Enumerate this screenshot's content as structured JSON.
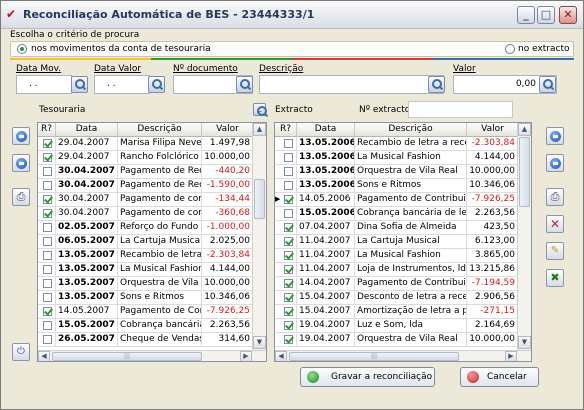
{
  "window": {
    "title": "Reconciliação Automática de BES - 23444333/1",
    "min": "_",
    "max": "□",
    "close": "✕"
  },
  "criteria": {
    "label": "Escolha o critério de procura",
    "option1": "nos movimentos da conta de tesouraria",
    "option2": "no extracto",
    "selected": "option1"
  },
  "filters": {
    "data_mov_label": "Data Mov.",
    "data_mov_value": ". .",
    "data_valor_label": "Data Valor",
    "data_valor_value": ". .",
    "doc_label": "Nº documento",
    "doc_value": "",
    "desc_label": "Descrição",
    "desc_value": "",
    "valor_label": "Valor",
    "valor_value": "0,00"
  },
  "colors": {
    "stripe1": "#f4c430",
    "stripe2": "#2f9a2f",
    "stripe3": "#d33a3a",
    "stripe4": "#3b6ea8",
    "negative": "#d21a1a"
  },
  "tesouraria": {
    "label": "Tesouraria",
    "c_label": "c",
    "columns": [
      "R?",
      "Data",
      "Descrição",
      "Valor"
    ],
    "rows": [
      {
        "checked": true,
        "bold": false,
        "date": "29.04.2007",
        "desc": "Marisa Filipa Neves I",
        "value": "1.497,98",
        "neg": false
      },
      {
        "checked": true,
        "bold": false,
        "date": "29.04.2007",
        "desc": "Rancho Folclórico da",
        "value": "10.000,00",
        "neg": false
      },
      {
        "checked": false,
        "bold": true,
        "date": "30.04.2007",
        "desc": "Pagamento de Recib",
        "value": "-440,20",
        "neg": true
      },
      {
        "checked": false,
        "bold": true,
        "date": "30.04.2007",
        "desc": "Pagamento de Recib",
        "value": "-1.590,00",
        "neg": true
      },
      {
        "checked": true,
        "bold": false,
        "date": "30.04.2007",
        "desc": "Pagamento de comis",
        "value": "-134,44",
        "neg": true
      },
      {
        "checked": true,
        "bold": false,
        "date": "30.04.2007",
        "desc": "Pagamento de comis",
        "value": "-360,68",
        "neg": true
      },
      {
        "checked": false,
        "bold": true,
        "date": "02.05.2007",
        "desc": "Reforço do Fundo d",
        "value": "-1.000,00",
        "neg": true
      },
      {
        "checked": false,
        "bold": true,
        "date": "06.05.2007",
        "desc": "La Cartuja Musical",
        "value": "2.025,00",
        "neg": false
      },
      {
        "checked": false,
        "bold": true,
        "date": "13.05.2007",
        "desc": "Recambio de letra a",
        "value": "-2.303,84",
        "neg": true
      },
      {
        "checked": false,
        "bold": true,
        "date": "13.05.2007",
        "desc": "La Musical Fashion",
        "value": "4.144,00",
        "neg": false
      },
      {
        "checked": false,
        "bold": true,
        "date": "13.05.2007",
        "desc": "Orquestra de Vila Re",
        "value": "10.000,00",
        "neg": false
      },
      {
        "checked": false,
        "bold": true,
        "date": "13.05.2007",
        "desc": "Sons e Ritmos",
        "value": "10.346,06",
        "neg": false
      },
      {
        "checked": true,
        "bold": false,
        "date": "14.05.2007",
        "desc": "Pagamento de Cont",
        "value": "-7.926,25",
        "neg": true
      },
      {
        "checked": false,
        "bold": true,
        "date": "15.05.2007",
        "desc": "Cobrança bancária c",
        "value": "2.263,56",
        "neg": false
      },
      {
        "checked": false,
        "bold": true,
        "date": "26.05.2007",
        "desc": "Cheque de Vendas a",
        "value": "314,60",
        "neg": false
      }
    ]
  },
  "extracto": {
    "label": "Extracto",
    "num_label": "Nº extracto",
    "num_value": "",
    "columns": [
      "R?",
      "Data",
      "Descrição",
      "Valor"
    ],
    "rows": [
      {
        "checked": false,
        "bold": true,
        "date": "13.05.2006",
        "desc": "Recambio de letra a recebe",
        "value": "-2.303,84",
        "neg": true
      },
      {
        "checked": false,
        "bold": true,
        "date": "13.05.2006",
        "desc": "La Musical Fashion",
        "value": "4.144,00",
        "neg": false
      },
      {
        "checked": false,
        "bold": true,
        "date": "13.05.2006",
        "desc": "Orquestra de Vila Real",
        "value": "10.000,00",
        "neg": false
      },
      {
        "checked": false,
        "bold": true,
        "date": "13.05.2006",
        "desc": "Sons e Ritmos",
        "value": "10.346,06",
        "neg": false
      },
      {
        "checked": true,
        "bold": false,
        "date": "14.05.2006",
        "desc": "Pagamento de Contribuiçõe",
        "value": "-7.926,25",
        "neg": true,
        "current": true
      },
      {
        "checked": false,
        "bold": true,
        "date": "15.05.2006",
        "desc": "Cobrança bancária de letra a",
        "value": "2.263,56",
        "neg": false
      },
      {
        "checked": true,
        "bold": false,
        "date": "07.04.2007",
        "desc": "Dina Sofia de Almeida",
        "value": "423,50",
        "neg": false
      },
      {
        "checked": true,
        "bold": false,
        "date": "11.04.2007",
        "desc": "La Cartuja Musical",
        "value": "6.123,00",
        "neg": false
      },
      {
        "checked": true,
        "bold": false,
        "date": "11.04.2007",
        "desc": "La Musical Fashion",
        "value": "3.865,00",
        "neg": false
      },
      {
        "checked": true,
        "bold": false,
        "date": "11.04.2007",
        "desc": "Loja de Instrumentos, lda",
        "value": "13.215,86",
        "neg": false
      },
      {
        "checked": true,
        "bold": false,
        "date": "14.04.2007",
        "desc": "Pagamento de Contribuiçõe",
        "value": "-7.194,59",
        "neg": true
      },
      {
        "checked": true,
        "bold": false,
        "date": "15.04.2007",
        "desc": "Desconto de letra a receber",
        "value": "2.906,56",
        "neg": false
      },
      {
        "checked": true,
        "bold": false,
        "date": "15.04.2007",
        "desc": "Amortização de letra a paga",
        "value": "-271,15",
        "neg": true
      },
      {
        "checked": true,
        "bold": false,
        "date": "19.04.2007",
        "desc": "Luz e Som, lda",
        "value": "2.164,69",
        "neg": false
      },
      {
        "checked": true,
        "bold": false,
        "date": "19.04.2007",
        "desc": "Orquestra de Vila Real",
        "value": "10.000,00",
        "neg": false
      }
    ]
  },
  "buttons": {
    "gravar": "Gravar a reconciliação",
    "cancelar": "Cancelar"
  }
}
